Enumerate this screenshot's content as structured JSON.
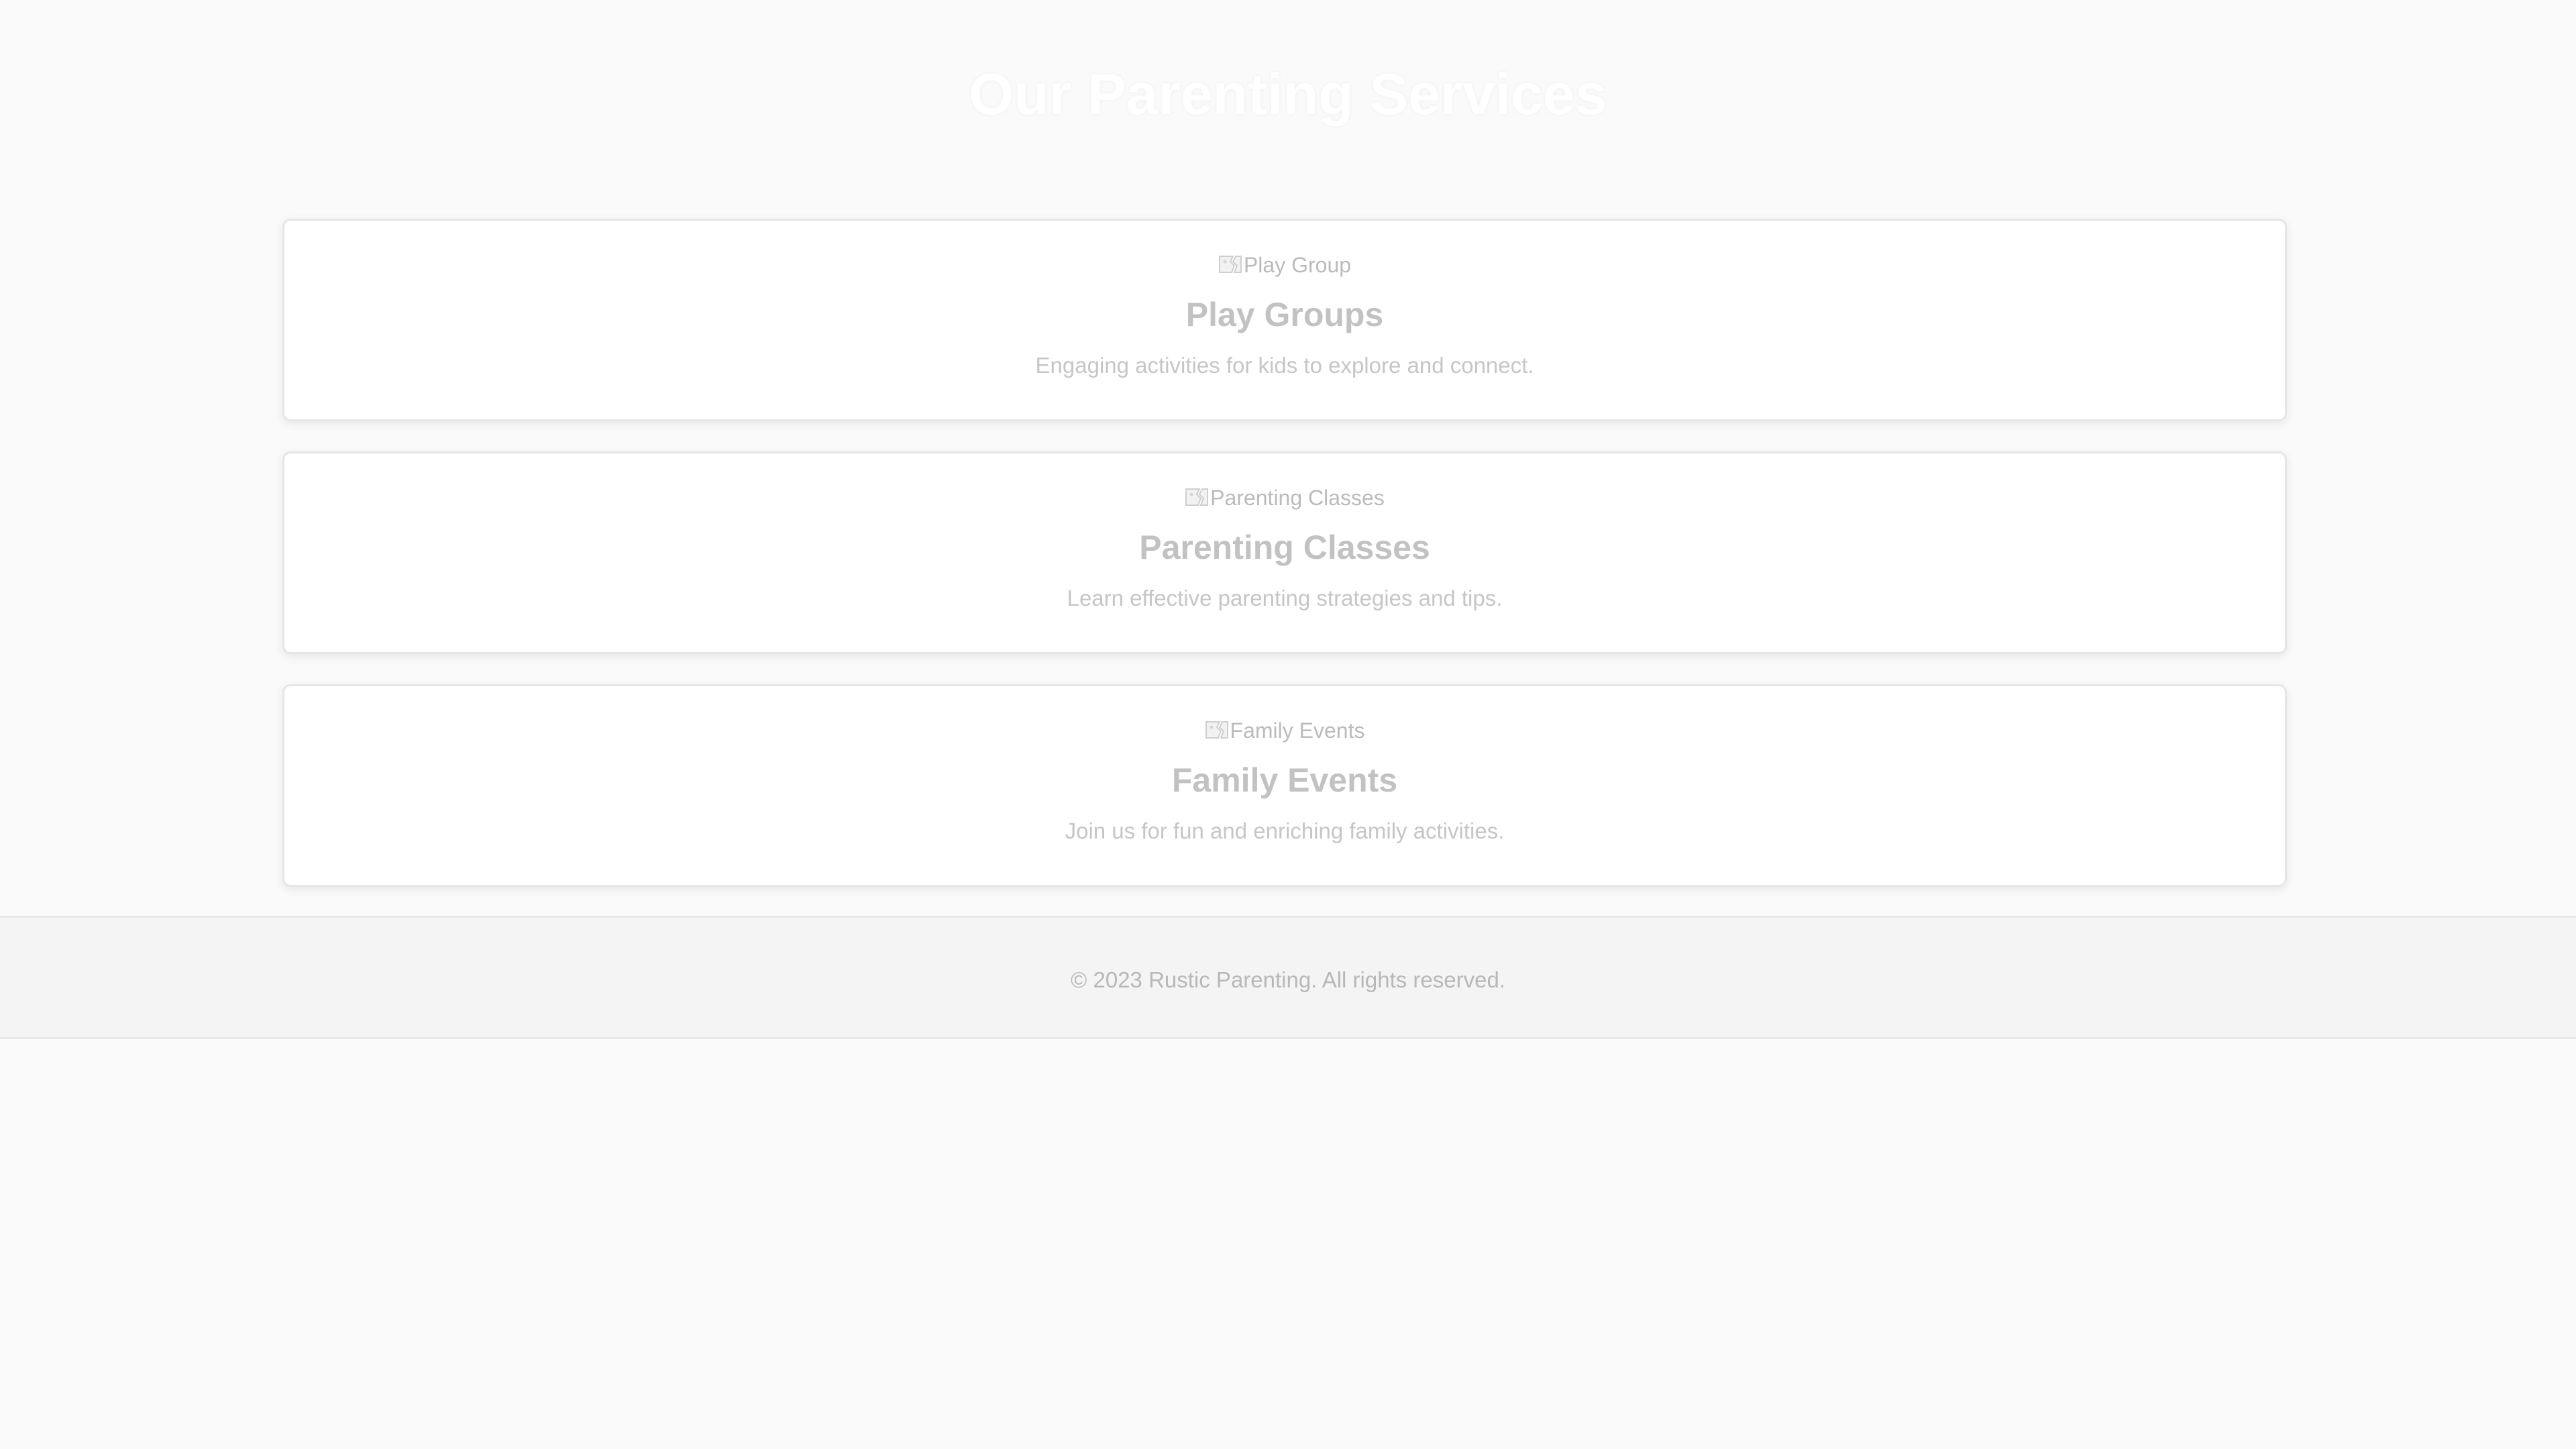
{
  "page": {
    "title": "Our Parenting Services"
  },
  "services": [
    {
      "image_alt": "Play Group",
      "title": "Play Groups",
      "description": "Engaging activities for kids to explore and connect."
    },
    {
      "image_alt": "Parenting Classes",
      "title": "Parenting Classes",
      "description": "Learn effective parenting strategies and tips."
    },
    {
      "image_alt": "Family Events",
      "title": "Family Events",
      "description": "Join us for fun and enriching family activities."
    }
  ],
  "footer": {
    "copyright": "© 2023 Rustic Parenting. All rights reserved."
  },
  "colors": {
    "background": "#fafafa",
    "card_background": "#ffffff",
    "card_border": "#e6e6e6",
    "footer_background": "#f4f4f4",
    "muted_text": "#c2c2c2"
  },
  "icons": {
    "service_image": "broken-image-icon"
  }
}
